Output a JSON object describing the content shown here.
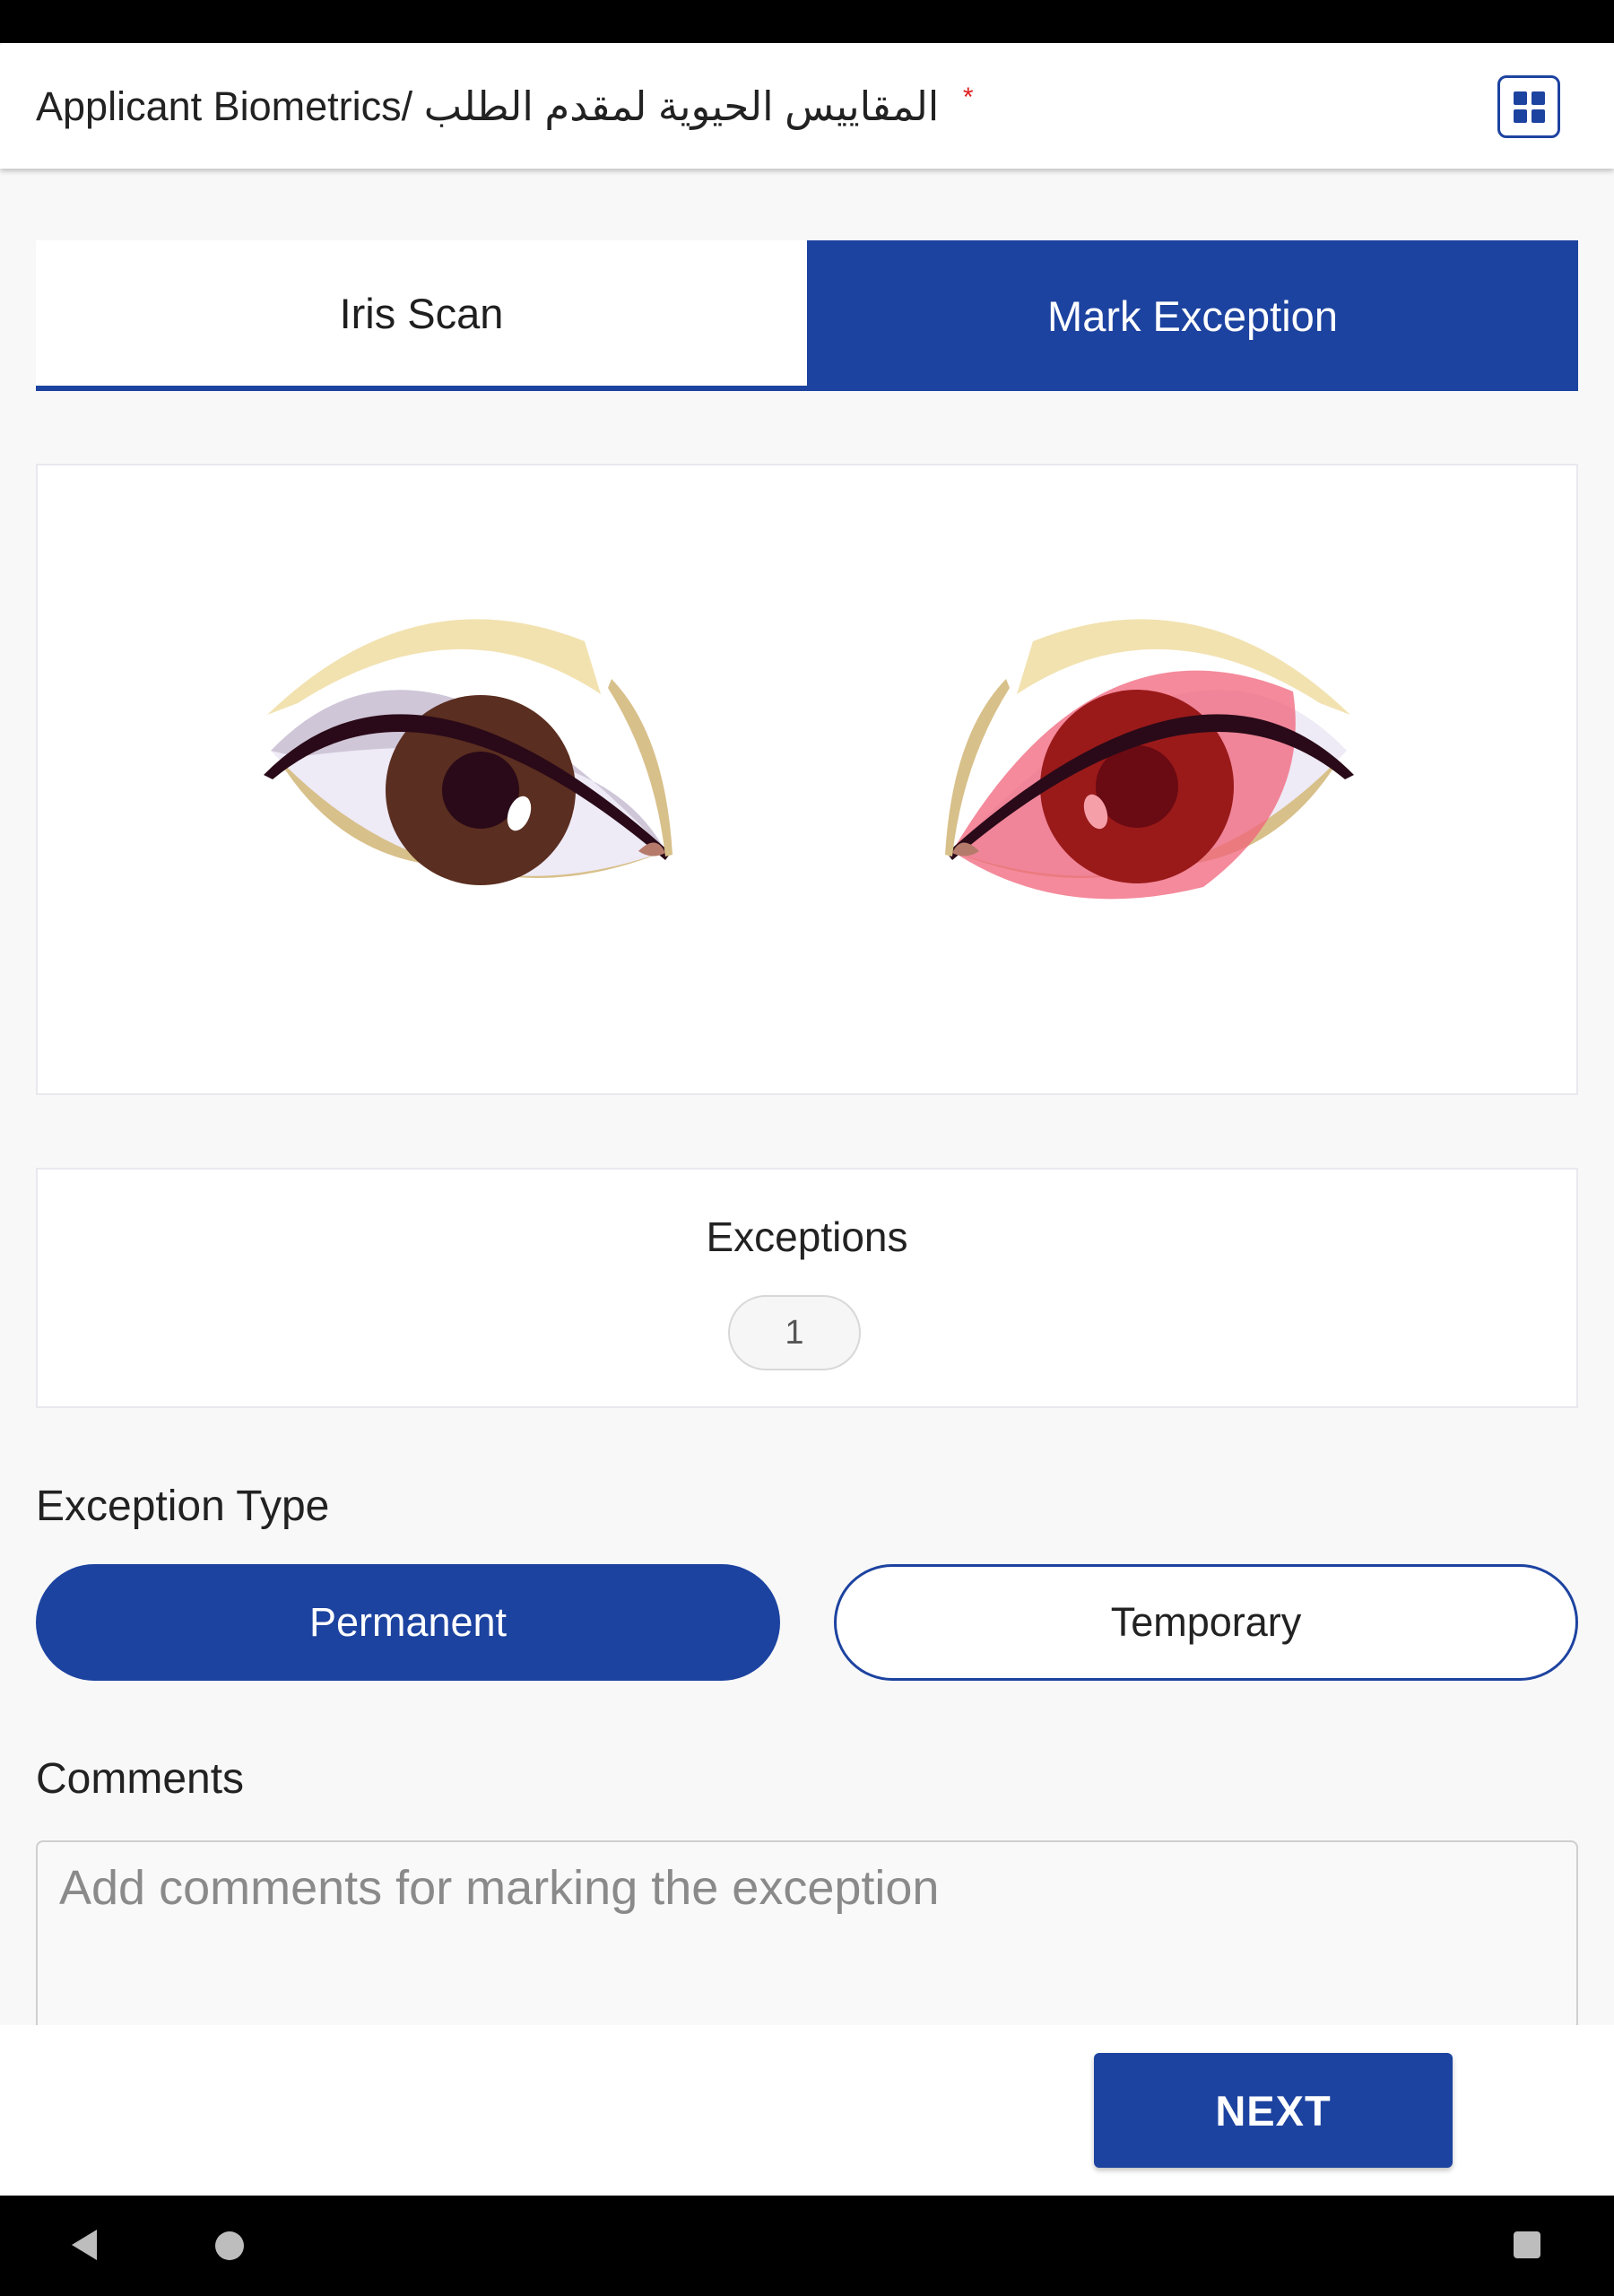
{
  "header": {
    "title_en": "Applicant Biometrics/",
    "title_ar": "المقاييس الحيوية لمقدم الطلب",
    "required_marker": "*",
    "grid_icon": "grid-icon"
  },
  "tabs": [
    {
      "label": "Iris Scan",
      "active": false
    },
    {
      "label": "Mark Exception",
      "active": true
    }
  ],
  "eyes": {
    "left": {
      "state": "normal",
      "iris_color": "#5a2e20"
    },
    "right": {
      "state": "exception",
      "iris_color": "#9a1a1a"
    }
  },
  "exceptions": {
    "title": "Exceptions",
    "count": "1"
  },
  "exception_type": {
    "label": "Exception Type",
    "options": [
      {
        "label": "Permanent",
        "selected": true
      },
      {
        "label": "Temporary",
        "selected": false
      }
    ]
  },
  "comments": {
    "label": "Comments",
    "placeholder": "Add comments for marking the exception",
    "value": ""
  },
  "footer": {
    "next_label": "NEXT"
  },
  "colors": {
    "primary": "#1d43a0",
    "required": "#e02020",
    "exception_highlight": "#f0637a"
  },
  "nav": {
    "back_icon": "back-icon",
    "home_icon": "home-icon",
    "recent_icon": "recent-apps-icon"
  }
}
